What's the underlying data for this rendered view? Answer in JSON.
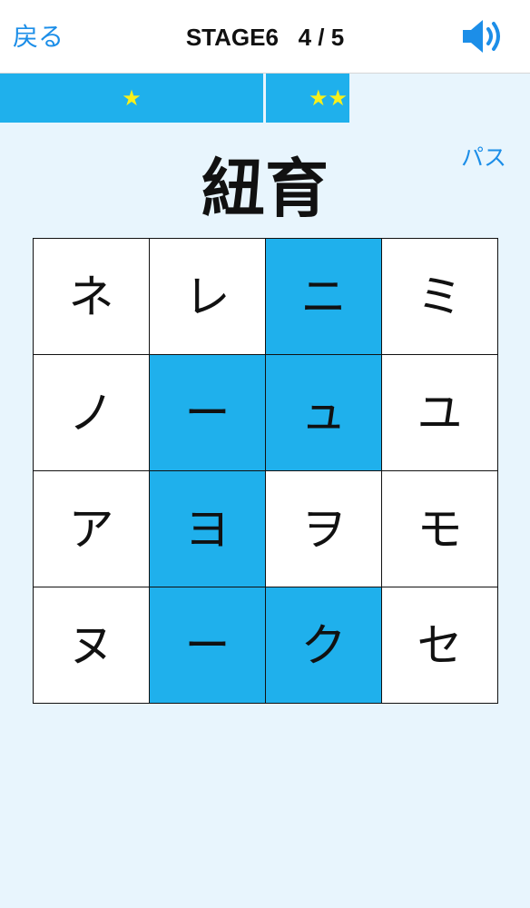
{
  "header": {
    "back_label": "戻る",
    "stage_label": "STAGE6   4 / 5",
    "sound_icon": "speaker-icon"
  },
  "progress": {
    "segments": [
      {
        "stars": "★"
      },
      {
        "stars": "★★"
      }
    ],
    "star_color": "#f8f01a",
    "bar_color": "#1fb0ec"
  },
  "pass_label": "パス",
  "question": "紐育",
  "grid": {
    "rows": [
      [
        {
          "char": "ネ",
          "selected": false
        },
        {
          "char": "レ",
          "selected": false
        },
        {
          "char": "ニ",
          "selected": true
        },
        {
          "char": "ミ",
          "selected": false
        }
      ],
      [
        {
          "char": "ノ",
          "selected": false
        },
        {
          "char": "ー",
          "selected": true
        },
        {
          "char": "ュ",
          "selected": true
        },
        {
          "char": "ユ",
          "selected": false
        }
      ],
      [
        {
          "char": "ア",
          "selected": false
        },
        {
          "char": "ヨ",
          "selected": true
        },
        {
          "char": "ヲ",
          "selected": false
        },
        {
          "char": "モ",
          "selected": false
        }
      ],
      [
        {
          "char": "ヌ",
          "selected": false
        },
        {
          "char": "ー",
          "selected": true
        },
        {
          "char": "ク",
          "selected": true
        },
        {
          "char": "セ",
          "selected": false
        }
      ]
    ],
    "selected_color": "#1fb0ec"
  }
}
